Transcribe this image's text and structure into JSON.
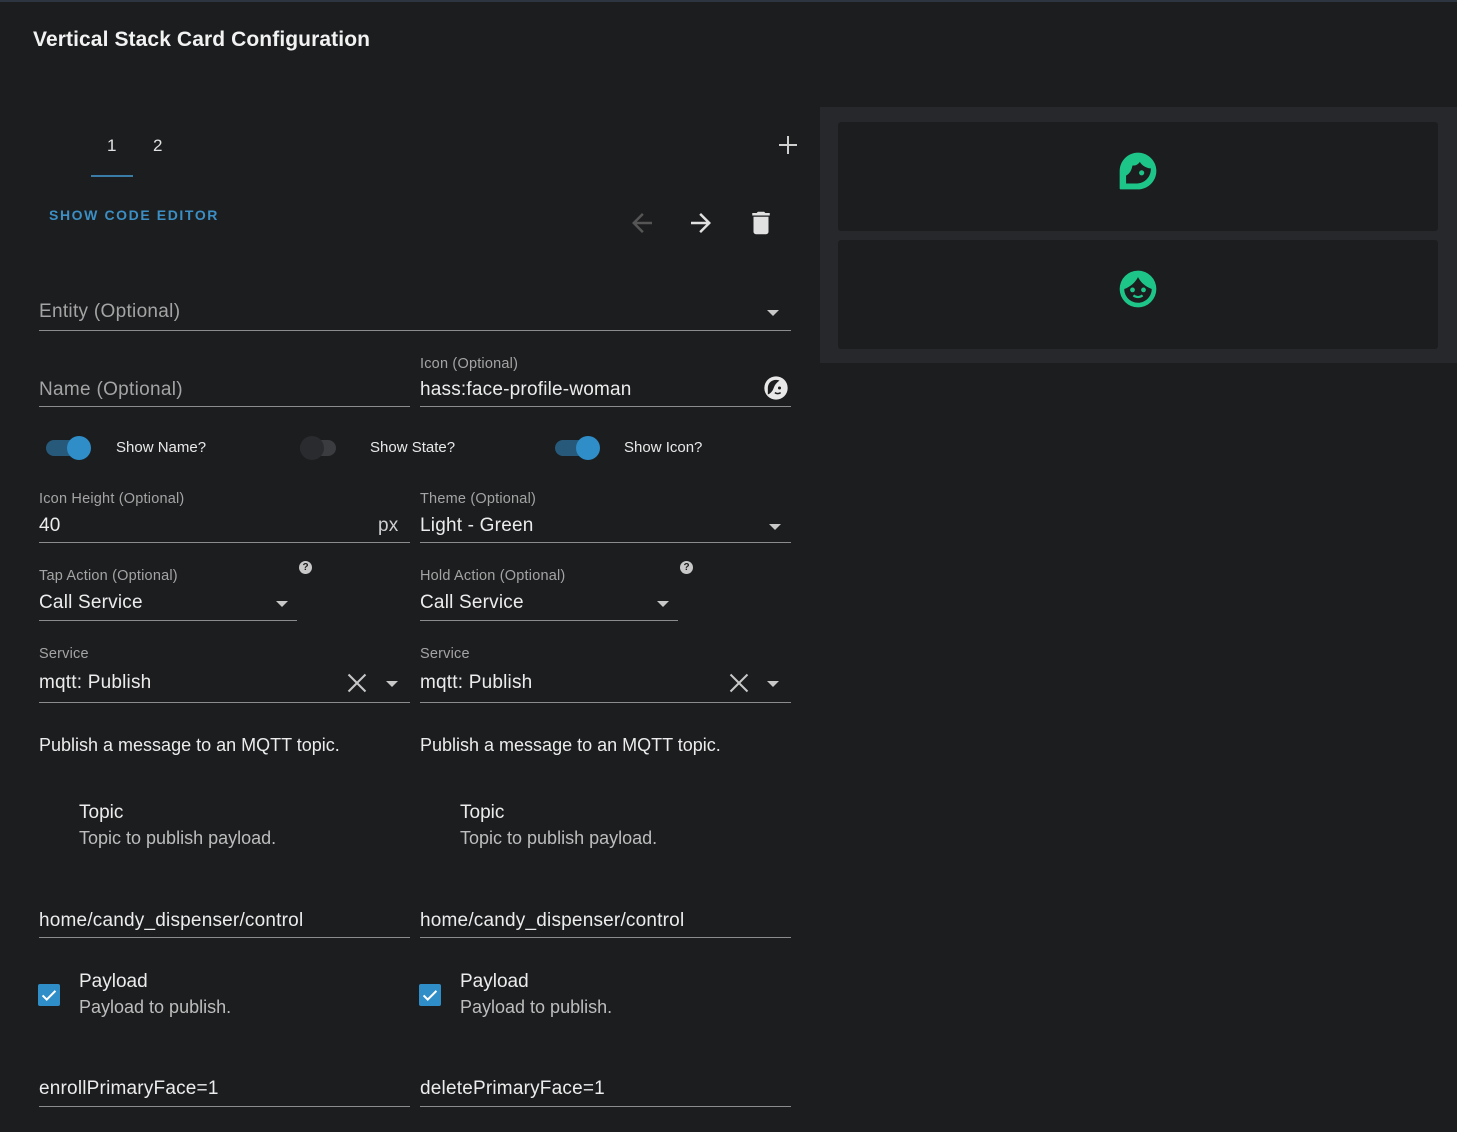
{
  "title": "Vertical Stack Card Configuration",
  "tabs": [
    {
      "label": "1"
    },
    {
      "label": "2"
    }
  ],
  "active_tab": "1",
  "actions": {
    "show_code_editor": "SHOW CODE EDITOR"
  },
  "entity": {
    "label": "Entity (Optional)",
    "value": ""
  },
  "name": {
    "label": "Name (Optional)",
    "value": ""
  },
  "icon": {
    "label": "Icon (Optional)",
    "value": "hass:face-profile-woman",
    "icon_name": "face-profile-woman-icon"
  },
  "toggles": [
    {
      "label": "Show Name?",
      "on": true
    },
    {
      "label": "Show State?",
      "on": false
    },
    {
      "label": "Show Icon?",
      "on": true
    }
  ],
  "icon_height": {
    "label": "Icon Height (Optional)",
    "value": "40",
    "suffix": "px"
  },
  "theme": {
    "label": "Theme (Optional)",
    "value": "Light - Green"
  },
  "tap_action": {
    "label": "Tap Action (Optional)",
    "value": "Call Service",
    "service_label": "Service",
    "service": "mqtt: Publish",
    "description": "Publish a message to an MQTT topic.",
    "topic_title": "Topic",
    "topic_desc": "Topic to publish payload.",
    "topic_value": "home/candy_dispenser/control",
    "payload_title": "Payload",
    "payload_desc": "Payload to publish.",
    "payload_checked": true,
    "payload_value": "enrollPrimaryFace=1"
  },
  "hold_action": {
    "label": "Hold Action (Optional)",
    "value": "Call Service",
    "service_label": "Service",
    "service": "mqtt: Publish",
    "description": "Publish a message to an MQTT topic.",
    "topic_title": "Topic",
    "topic_desc": "Topic to publish payload.",
    "topic_value": "home/candy_dispenser/control",
    "payload_title": "Payload",
    "payload_desc": "Payload to publish.",
    "payload_checked": true,
    "payload_value": "deletePrimaryFace=1"
  },
  "preview": {
    "cards": [
      {
        "icon": "face-profile-woman-icon"
      },
      {
        "icon": "face-man-icon"
      }
    ],
    "icon_color": "#1dc688"
  },
  "colors": {
    "accent": "#2f8dc8",
    "background": "#1c1d1f"
  }
}
